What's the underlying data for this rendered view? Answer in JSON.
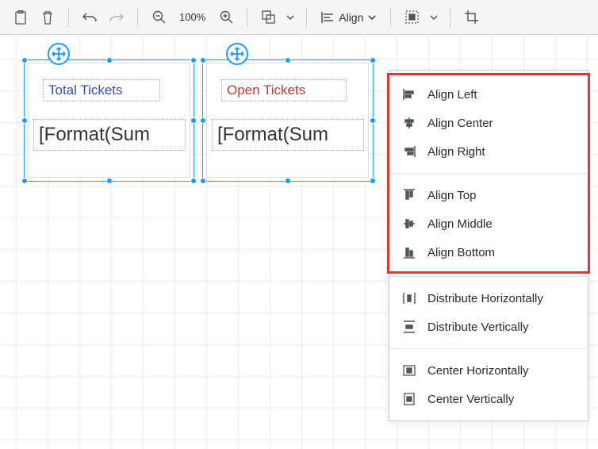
{
  "toolbar": {
    "zoom": "100%",
    "align_label": "Align"
  },
  "canvas": {
    "card1": {
      "title": "Total Tickets",
      "value": "[Format(Sum"
    },
    "card2": {
      "title": "Open Tickets",
      "value": "[Format(Sum"
    }
  },
  "dropdown": {
    "items": [
      {
        "label": "Align Left"
      },
      {
        "label": "Align Center"
      },
      {
        "label": "Align Right"
      },
      {
        "label": "Align Top"
      },
      {
        "label": "Align Middle"
      },
      {
        "label": "Align Bottom"
      },
      {
        "label": "Distribute Horizontally"
      },
      {
        "label": "Distribute Vertically"
      },
      {
        "label": "Center Horizontally"
      },
      {
        "label": "Center Vertically"
      }
    ]
  }
}
